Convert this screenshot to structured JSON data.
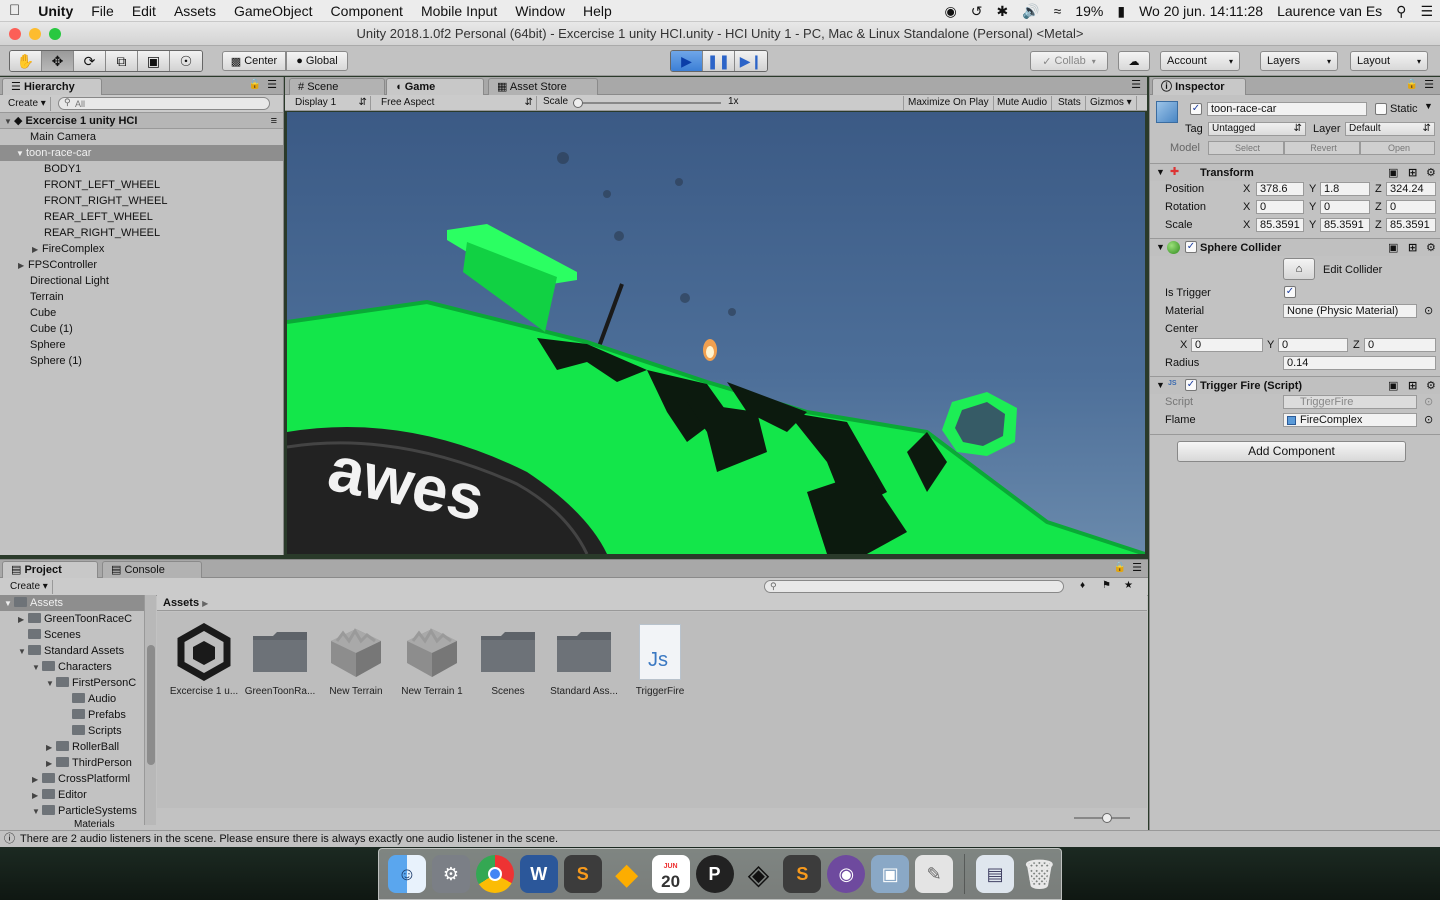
{
  "menubar": {
    "app": "Unity",
    "items": [
      "File",
      "Edit",
      "Assets",
      "GameObject",
      "Component",
      "Mobile Input",
      "Window",
      "Help"
    ],
    "battery": "19%",
    "datetime": "Wo 20 jun.  14:11:28",
    "user": "Laurence van Es"
  },
  "window": {
    "title": "Unity 2018.1.0f2 Personal (64bit) - Excercise 1 unity HCI.unity - HCI Unity 1 - PC, Mac & Linux Standalone (Personal) <Metal>"
  },
  "toolbar": {
    "pivot": "Center",
    "space": "Global",
    "collab": "Collab",
    "account": "Account",
    "layers": "Layers",
    "layout": "Layout"
  },
  "hierarchy": {
    "tab": "Hierarchy",
    "create": "Create",
    "search_placeholder": "All",
    "scene": "Excercise 1 unity HCI",
    "items": [
      "Main Camera",
      "toon-race-car",
      "BODY1",
      "FRONT_LEFT_WHEEL",
      "FRONT_RIGHT_WHEEL",
      "REAR_LEFT_WHEEL",
      "REAR_RIGHT_WHEEL",
      "FireComplex",
      "FPSController",
      "Directional Light",
      "Terrain",
      "Cube",
      "Cube (1)",
      "Sphere",
      "Sphere (1)"
    ]
  },
  "viewtabs": {
    "scene": "Scene",
    "game": "Game",
    "store": "Asset Store"
  },
  "gamebar": {
    "display": "Display 1",
    "aspect": "Free Aspect",
    "scale_label": "Scale",
    "scale_value": "1x",
    "scale_fraction": 0.0,
    "maximize": "Maximize On Play",
    "mute": "Mute Audio",
    "stats": "Stats",
    "gizmos": "Gizmos"
  },
  "game": {
    "tire_text": "awes"
  },
  "inspector": {
    "tab": "Inspector",
    "name": "toon-race-car",
    "static": "Static",
    "tag_label": "Tag",
    "tag": "Untagged",
    "layer_label": "Layer",
    "layer": "Default",
    "model_label": "Model",
    "model_buttons": [
      "Select",
      "Revert",
      "Open"
    ],
    "transform": {
      "title": "Transform",
      "position_label": "Position",
      "position": [
        "378.6",
        "1.8",
        "324.24"
      ],
      "rotation_label": "Rotation",
      "rotation": [
        "0",
        "0",
        "0"
      ],
      "scale_label": "Scale",
      "scale": [
        "85.3591",
        "85.3591",
        "85.3591"
      ]
    },
    "axes": [
      "X",
      "Y",
      "Z"
    ],
    "collider": {
      "title": "Sphere Collider",
      "edit": "Edit Collider",
      "trigger_label": "Is Trigger",
      "material_label": "Material",
      "material": "None (Physic Material)",
      "center_label": "Center",
      "center": [
        "0",
        "0",
        "0"
      ],
      "radius_label": "Radius",
      "radius": "0.14"
    },
    "script": {
      "title": "Trigger Fire (Script)",
      "script_label": "Script",
      "script": "TriggerFire",
      "flame_label": "Flame",
      "flame": "FireComplex"
    },
    "add_component": "Add Component"
  },
  "project": {
    "tab": "Project",
    "console_tab": "Console",
    "create": "Create",
    "breadcrumb": "Assets",
    "tree": [
      "Assets",
      "GreenToonRaceC",
      "Scenes",
      "Standard Assets",
      "Characters",
      "FirstPersonC",
      "Audio",
      "Prefabs",
      "Scripts",
      "RollerBall",
      "ThirdPerson",
      "CrossPlatforml",
      "Editor",
      "ParticleSystems",
      "Materials"
    ],
    "assets": [
      {
        "label": "Excercise 1 u...",
        "icon": "unity-scene-icon"
      },
      {
        "label": "GreenToonRa...",
        "icon": "folder-icon"
      },
      {
        "label": "New Terrain",
        "icon": "terrain-icon"
      },
      {
        "label": "New Terrain 1",
        "icon": "terrain-icon"
      },
      {
        "label": "Scenes",
        "icon": "folder-icon"
      },
      {
        "label": "Standard Ass...",
        "icon": "folder-icon"
      },
      {
        "label": "TriggerFire",
        "icon": "js-script-icon"
      }
    ],
    "js_label": "Js"
  },
  "status": {
    "message": "There are 2 audio listeners in the scene. Please ensure there is always exactly one audio listener in the scene."
  },
  "dock": {
    "calendar_month": "JUN",
    "calendar_day": "20"
  }
}
